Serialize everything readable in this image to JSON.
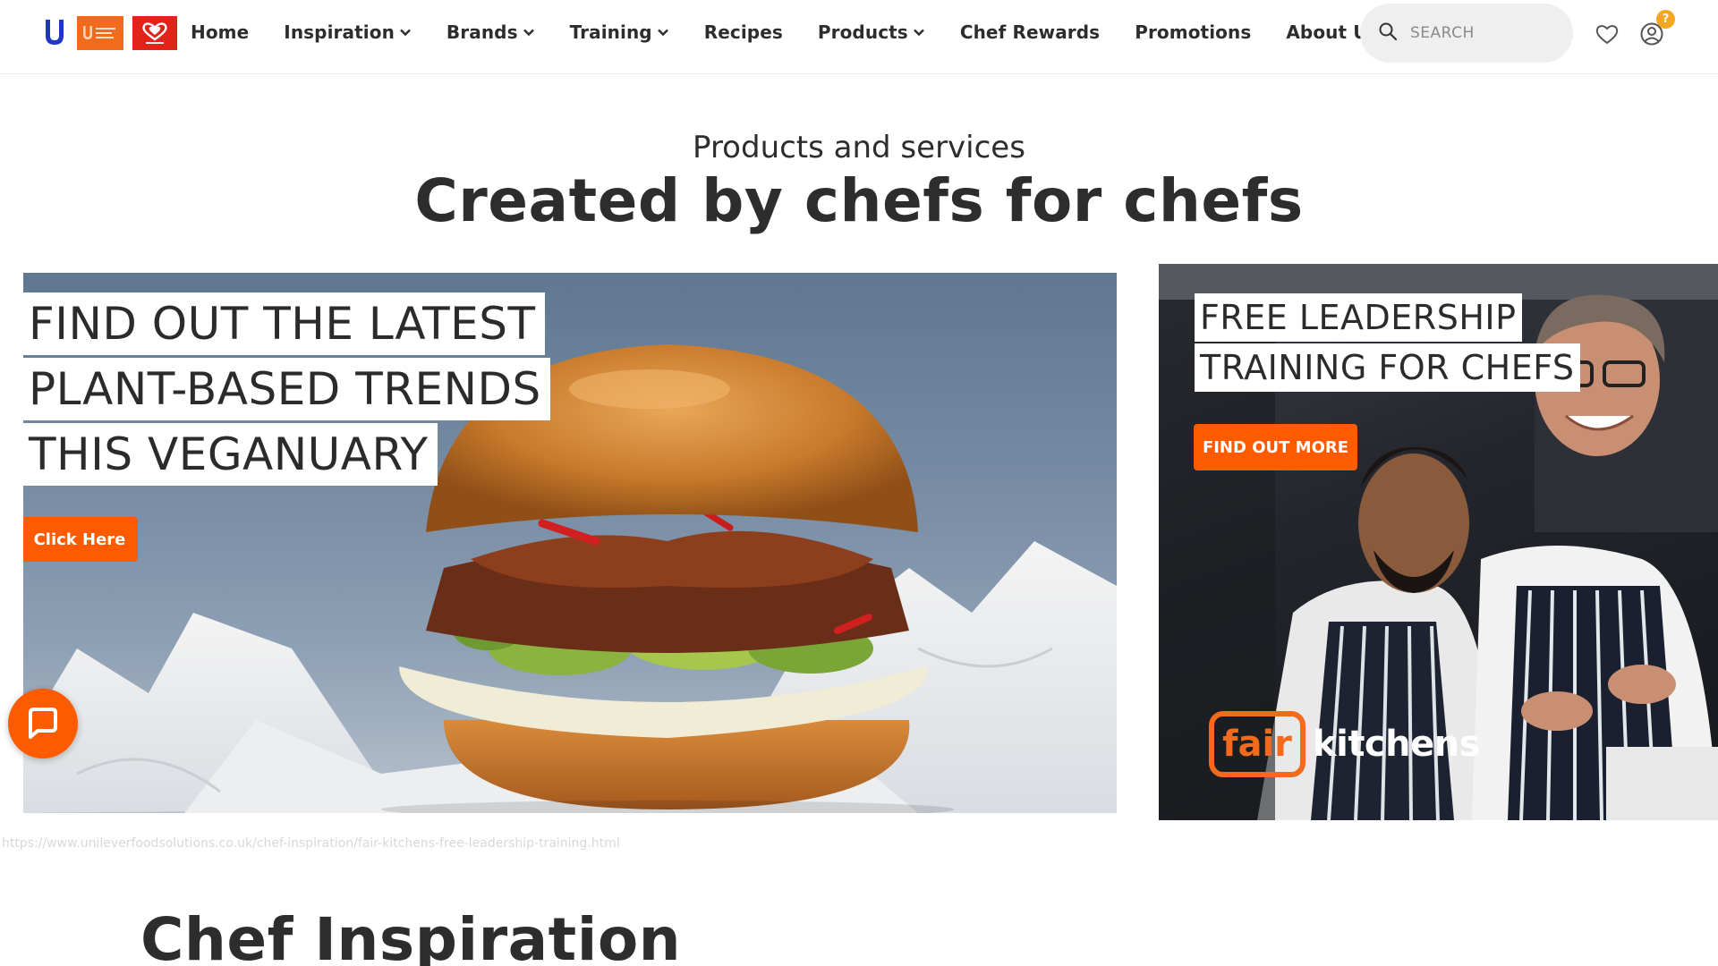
{
  "header": {
    "logos": {
      "unilever": "Unilever",
      "ufs": "Unilever Food Solutions",
      "walls": "WALL'S"
    },
    "nav": [
      {
        "label": "Home",
        "has_dropdown": false
      },
      {
        "label": "Inspiration",
        "has_dropdown": true
      },
      {
        "label": "Brands",
        "has_dropdown": true
      },
      {
        "label": "Training",
        "has_dropdown": true
      },
      {
        "label": "Recipes",
        "has_dropdown": false
      },
      {
        "label": "Products",
        "has_dropdown": true
      },
      {
        "label": "Chef Rewards",
        "has_dropdown": false
      },
      {
        "label": "Promotions",
        "has_dropdown": false
      },
      {
        "label": "About Us",
        "has_dropdown": false
      }
    ],
    "search": {
      "placeholder": "SEARCH",
      "icon": "search-icon"
    },
    "icons": {
      "favorites": "heart-icon",
      "account": "user-account-icon"
    },
    "account_badge": "?"
  },
  "hero": {
    "subtitle": "Products and services",
    "title": "Created by chefs for chefs"
  },
  "promo_left": {
    "headline": [
      "FIND OUT THE LATEST",
      "PLANT-BASED TRENDS",
      "THIS VEGANUARY"
    ],
    "button_label": "Click Here"
  },
  "promo_right": {
    "headline": [
      "FREE LEADERSHIP",
      "TRAINING FOR CHEFS"
    ],
    "button_label": "FIND OUT MORE",
    "brand_fair": "fair",
    "brand_kitchens": "kitchens"
  },
  "status_bar_url": "https://www.unileverfoodsolutions.co.uk/chef-inspiration/fair-kitchens-free-leadership-training.html",
  "section": {
    "heading": "Chef Inspiration"
  },
  "colors": {
    "accent_orange": "#fe5a00",
    "ufs_orange": "#f26b1d",
    "walls_red": "#e2231a",
    "unilever_blue": "#1f36c7",
    "badge_yellow": "#f5a623",
    "text_dark": "#2d2d2d"
  }
}
